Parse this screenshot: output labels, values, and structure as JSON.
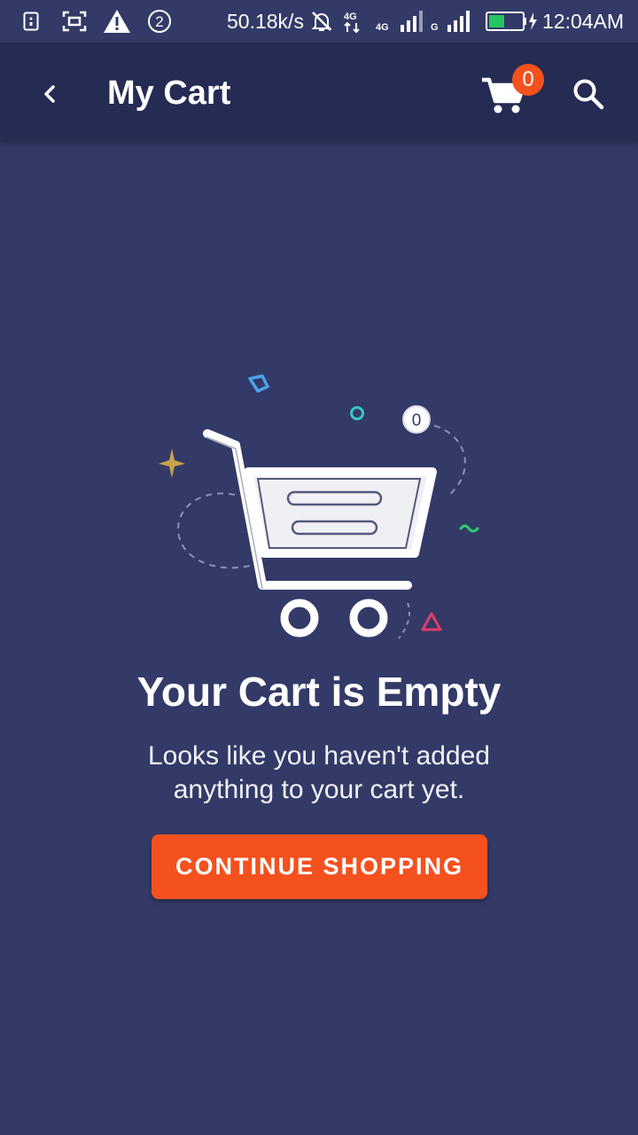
{
  "status_bar": {
    "notification_count": "2",
    "network_speed": "50.18k/s",
    "network_type_1": "4G",
    "network_type_2": "G",
    "time": "12:04AM",
    "battery_color": "#22c55e"
  },
  "app_bar": {
    "title": "My Cart",
    "cart_count": "0",
    "icons": [
      "back-arrow-icon",
      "cart-icon",
      "search-icon"
    ]
  },
  "empty_state": {
    "cart_badge_value": "0",
    "title": "Your Cart is Empty",
    "message": "Looks like you haven't added anything to your cart yet.",
    "button_label": "CONTINUE SHOPPING"
  },
  "colors": {
    "background": "#333a67",
    "app_bar": "#262b54",
    "accent": "#f4511e"
  }
}
